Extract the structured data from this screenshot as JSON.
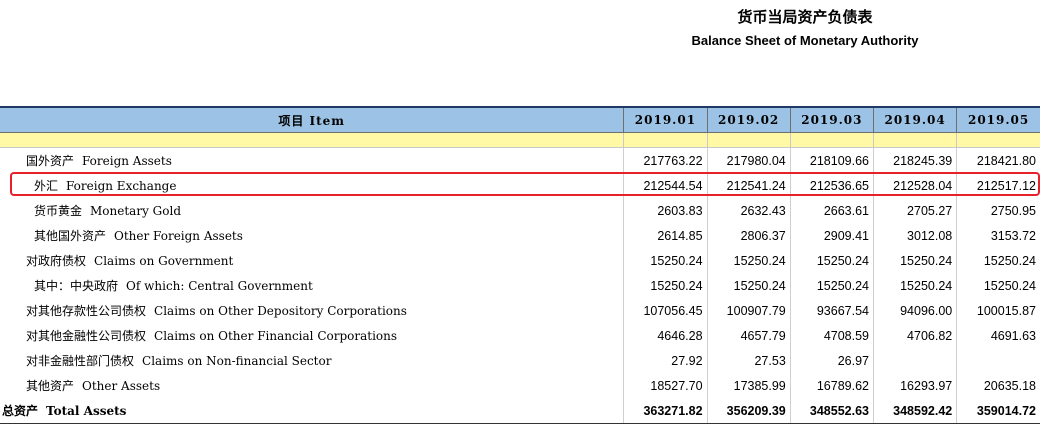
{
  "title": {
    "zh": "货币当局资产负债表",
    "en": "Balance Sheet of  Monetary Authority"
  },
  "header": {
    "item_label": "项目 Item",
    "periods": [
      "2019.01",
      "2019.02",
      "2019.03",
      "2019.04",
      "2019.05"
    ]
  },
  "rows": [
    {
      "zh": "国外资产",
      "en": "Foreign Assets",
      "values": [
        "217763.22",
        "217980.04",
        "218109.66",
        "218245.39",
        "218421.80"
      ]
    },
    {
      "zh": "外汇",
      "en": "Foreign Exchange",
      "values": [
        "212544.54",
        "212541.24",
        "212536.65",
        "212528.04",
        "212517.12"
      ]
    },
    {
      "zh": "货币黄金",
      "en": "Monetary Gold",
      "values": [
        "2603.83",
        "2632.43",
        "2663.61",
        "2705.27",
        "2750.95"
      ]
    },
    {
      "zh": "其他国外资产",
      "en": "Other Foreign Assets",
      "values": [
        "2614.85",
        "2806.37",
        "2909.41",
        "3012.08",
        "3153.72"
      ]
    },
    {
      "zh": "对政府债权",
      "en": "Claims on Government",
      "values": [
        "15250.24",
        "15250.24",
        "15250.24",
        "15250.24",
        "15250.24"
      ]
    },
    {
      "zh": "其中：中央政府",
      "en": "Of which: Central Government",
      "values": [
        "15250.24",
        "15250.24",
        "15250.24",
        "15250.24",
        "15250.24"
      ]
    },
    {
      "zh": "对其他存款性公司债权",
      "en": "Claims on Other Depository Corporations",
      "values": [
        "107056.45",
        "100907.79",
        "93667.54",
        "94096.00",
        "100015.87"
      ]
    },
    {
      "zh": "对其他金融性公司债权",
      "en": "Claims on Other Financial Corporations",
      "values": [
        "4646.28",
        "4657.79",
        "4708.59",
        "4706.82",
        "4691.63"
      ]
    },
    {
      "zh": "对非金融性部门债权",
      "en": "Claims on Non-financial Sector",
      "values": [
        "27.92",
        "27.53",
        "26.97",
        "",
        ""
      ]
    },
    {
      "zh": "其他资产",
      "en": "Other Assets",
      "values": [
        "18527.70",
        "17385.99",
        "16789.62",
        "16293.97",
        "20635.18"
      ]
    },
    {
      "zh": "总资产",
      "en": "Total Assets",
      "values": [
        "363271.82",
        "356209.39",
        "348552.63",
        "348592.42",
        "359014.72"
      ]
    }
  ],
  "highlight_color": "#e8202a"
}
